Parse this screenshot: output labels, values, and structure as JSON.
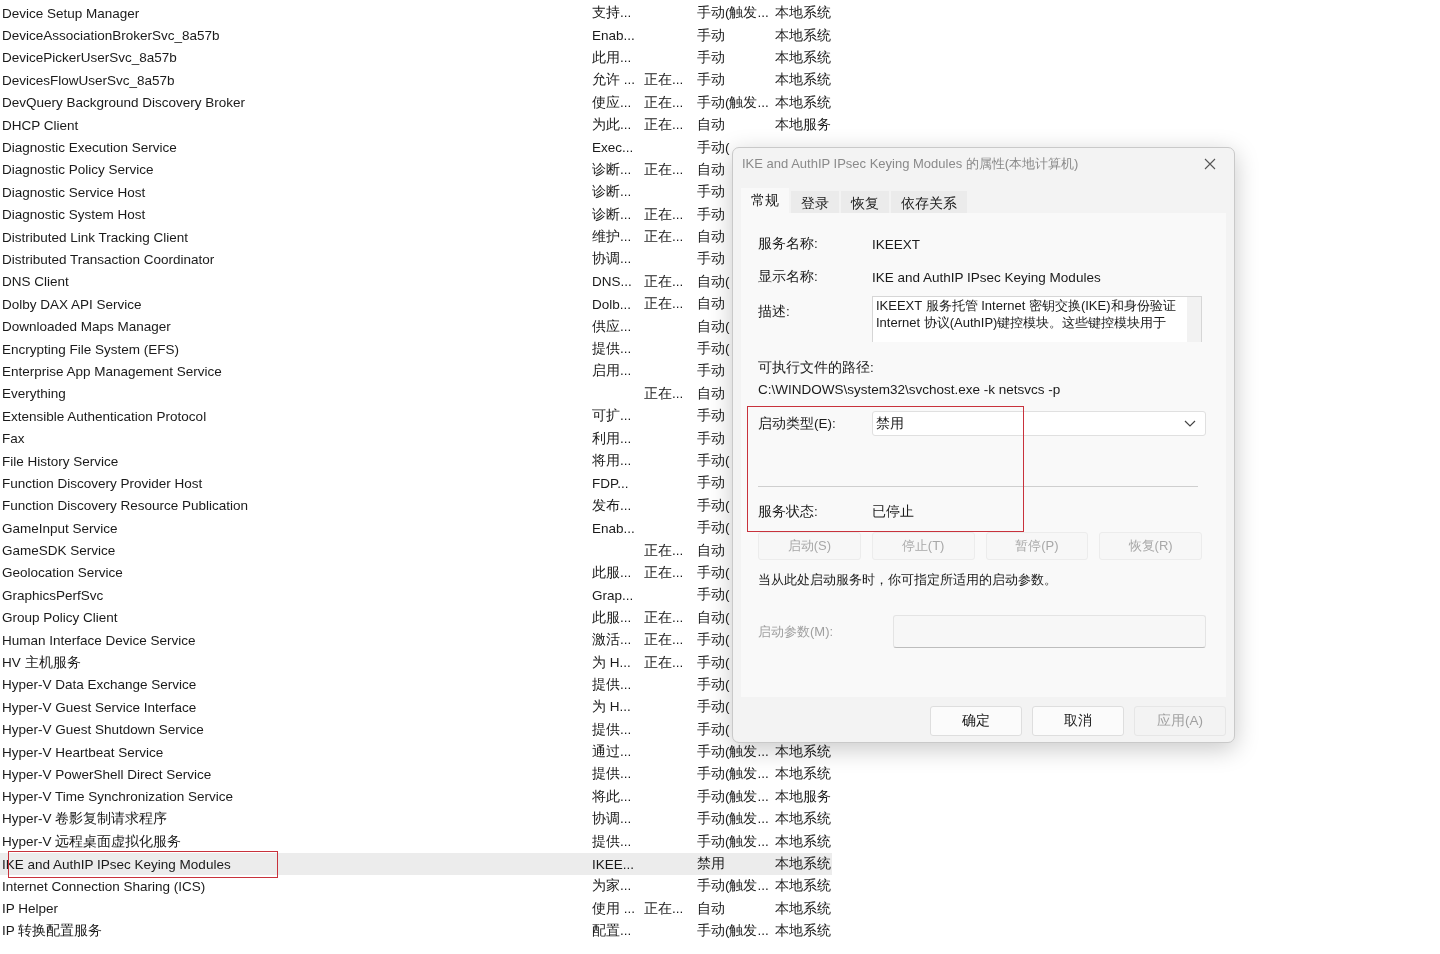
{
  "services": {
    "rows": [
      {
        "name": "Device Setup Manager",
        "description": "支持...",
        "startup_type": "手动(触发...",
        "log_on_as": "本地系统",
        "selected": false
      },
      {
        "name": "DeviceAssociationBrokerSvc_8a57b",
        "description": "Enab...",
        "startup_type": "手动",
        "log_on_as": "本地系统",
        "selected": false
      },
      {
        "name": "DevicePickerUserSvc_8a57b",
        "description": "此用...",
        "startup_type": "手动",
        "log_on_as": "本地系统",
        "selected": false
      },
      {
        "name": "DevicesFlowUserSvc_8a57b",
        "description": "允许 ...",
        "status": "正在...",
        "startup_type": "手动",
        "log_on_as": "本地系统",
        "selected": false
      },
      {
        "name": "DevQuery Background Discovery Broker",
        "description": "使应...",
        "status": "正在...",
        "startup_type": "手动(触发...",
        "log_on_as": "本地系统",
        "selected": false
      },
      {
        "name": "DHCP Client",
        "description": "为此...",
        "status": "正在...",
        "startup_type": "自动",
        "log_on_as": "本地服务",
        "selected": false
      },
      {
        "name": "Diagnostic Execution Service",
        "description": "Exec...",
        "startup_type": "手动(",
        "selected": false
      },
      {
        "name": "Diagnostic Policy Service",
        "description": "诊断...",
        "status": "正在...",
        "startup_type": "自动",
        "selected": false
      },
      {
        "name": "Diagnostic Service Host",
        "description": "诊断...",
        "startup_type": "手动",
        "selected": false
      },
      {
        "name": "Diagnostic System Host",
        "description": "诊断...",
        "status": "正在...",
        "startup_type": "手动",
        "selected": false
      },
      {
        "name": "Distributed Link Tracking Client",
        "description": "维护...",
        "status": "正在...",
        "startup_type": "自动",
        "selected": false
      },
      {
        "name": "Distributed Transaction Coordinator",
        "description": "协调...",
        "startup_type": "手动",
        "selected": false
      },
      {
        "name": "DNS Client",
        "description": "DNS...",
        "status": "正在...",
        "startup_type": "自动(",
        "selected": false
      },
      {
        "name": "Dolby DAX API Service",
        "description": "Dolb...",
        "status": "正在...",
        "startup_type": "自动",
        "selected": false
      },
      {
        "name": "Downloaded Maps Manager",
        "description": "供应...",
        "startup_type": "自动(",
        "selected": false
      },
      {
        "name": "Encrypting File System (EFS)",
        "description": "提供...",
        "startup_type": "手动(",
        "selected": false
      },
      {
        "name": "Enterprise App Management Service",
        "description": "启用...",
        "startup_type": "手动",
        "selected": false
      },
      {
        "name": "Everything",
        "status": "正在...",
        "startup_type": "自动",
        "selected": false
      },
      {
        "name": "Extensible Authentication Protocol",
        "description": "可扩...",
        "startup_type": "手动",
        "selected": false
      },
      {
        "name": "Fax",
        "description": "利用...",
        "startup_type": "手动",
        "selected": false
      },
      {
        "name": "File History Service",
        "description": "将用...",
        "startup_type": "手动(",
        "selected": false
      },
      {
        "name": "Function Discovery Provider Host",
        "description": "FDP...",
        "startup_type": "手动",
        "selected": false
      },
      {
        "name": "Function Discovery Resource Publication",
        "description": "发布...",
        "startup_type": "手动(",
        "selected": false
      },
      {
        "name": "GameInput Service",
        "description": "Enab...",
        "startup_type": "手动(",
        "selected": false
      },
      {
        "name": "GameSDK Service",
        "status": "正在...",
        "startup_type": "自动",
        "selected": false
      },
      {
        "name": "Geolocation Service",
        "description": "此服...",
        "status": "正在...",
        "startup_type": "手动(",
        "selected": false
      },
      {
        "name": "GraphicsPerfSvc",
        "description": "Grap...",
        "startup_type": "手动(",
        "selected": false
      },
      {
        "name": "Group Policy Client",
        "description": "此服...",
        "status": "正在...",
        "startup_type": "自动(",
        "selected": false
      },
      {
        "name": "Human Interface Device Service",
        "description": "激活...",
        "status": "正在...",
        "startup_type": "手动(",
        "selected": false
      },
      {
        "name": "HV 主机服务",
        "description": "为 H...",
        "status": "正在...",
        "startup_type": "手动(",
        "selected": false
      },
      {
        "name": "Hyper-V Data Exchange Service",
        "description": "提供...",
        "startup_type": "手动(",
        "selected": false
      },
      {
        "name": "Hyper-V Guest Service Interface",
        "description": "为 H...",
        "startup_type": "手动(",
        "selected": false
      },
      {
        "name": "Hyper-V Guest Shutdown Service",
        "description": "提供...",
        "startup_type": "手动(",
        "selected": false
      },
      {
        "name": "Hyper-V Heartbeat Service",
        "description": "通过...",
        "startup_type": "手动(触发...",
        "log_on_as": "本地系统",
        "selected": false
      },
      {
        "name": "Hyper-V PowerShell Direct Service",
        "description": "提供...",
        "startup_type": "手动(触发...",
        "log_on_as": "本地系统",
        "selected": false
      },
      {
        "name": "Hyper-V Time Synchronization Service",
        "description": "将此...",
        "startup_type": "手动(触发...",
        "log_on_as": "本地服务",
        "selected": false
      },
      {
        "name": "Hyper-V 卷影复制请求程序",
        "description": "协调...",
        "startup_type": "手动(触发...",
        "log_on_as": "本地系统",
        "selected": false
      },
      {
        "name": "Hyper-V 远程桌面虚拟化服务",
        "description": "提供...",
        "startup_type": "手动(触发...",
        "log_on_as": "本地系统",
        "selected": false
      },
      {
        "name": "IKE and AuthIP IPsec Keying Modules",
        "description": "IKEE...",
        "startup_type": "禁用",
        "log_on_as": "本地系统",
        "selected": true
      },
      {
        "name": "Internet Connection Sharing (ICS)",
        "description": "为家...",
        "startup_type": "手动(触发...",
        "log_on_as": "本地系统",
        "selected": false
      },
      {
        "name": "IP Helper",
        "description": "使用 ...",
        "status": "正在...",
        "startup_type": "自动",
        "log_on_as": "本地系统",
        "selected": false
      },
      {
        "name": "IP 转换配置服务",
        "description": "配置...",
        "startup_type": "手动(触发...",
        "log_on_as": "本地系统",
        "selected": false
      }
    ]
  },
  "dialog": {
    "title": "IKE and AuthIP IPsec Keying Modules 的属性(本地计算机)",
    "tabs": [
      {
        "label": "常规",
        "selected": true
      },
      {
        "label": "登录",
        "selected": false
      },
      {
        "label": "恢复",
        "selected": false
      },
      {
        "label": "依存关系",
        "selected": false
      }
    ],
    "service_name": {
      "label": "服务名称:",
      "value": "IKEEXT"
    },
    "display_name": {
      "label": "显示名称:",
      "value": "IKE and AuthIP IPsec Keying Modules"
    },
    "description": {
      "label": "描述:",
      "lines": [
        "IKEEXT 服务托管 Internet 密钥交换(IKE)和身份验证",
        "Internet 协议(AuthIP)键控模块。这些键控模块用于"
      ]
    },
    "executable_path": {
      "label": "可执行文件的路径:",
      "value": "C:\\WINDOWS\\system32\\svchost.exe -k netsvcs -p"
    },
    "startup_type": {
      "label": "启动类型(E):",
      "value": "禁用"
    },
    "service_status": {
      "label": "服务状态:",
      "value": "已停止"
    },
    "control_buttons": [
      {
        "label": "启动(S)",
        "disabled": true
      },
      {
        "label": "停止(T)",
        "disabled": true
      },
      {
        "label": "暂停(P)",
        "disabled": true
      },
      {
        "label": "恢复(R)",
        "disabled": true
      }
    ],
    "hint": "当从此处启动服务时，你可指定所适用的启动参数。",
    "start_parameters": {
      "label": "启动参数(M):",
      "disabled": true
    },
    "buttons": [
      {
        "label": "确定",
        "disabled": false
      },
      {
        "label": "取消",
        "disabled": false
      },
      {
        "label": "应用(A)",
        "disabled": true
      }
    ]
  }
}
